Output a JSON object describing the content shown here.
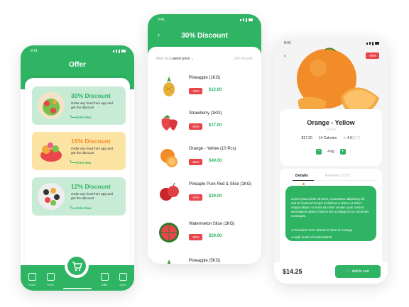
{
  "offer_screen": {
    "time": "9:41",
    "title": "Offer",
    "offers": [
      {
        "title": "30% Discount",
        "desc": "Order any food from app and get the discount",
        "cta": "Order Now"
      },
      {
        "title": "15% Discount",
        "desc": "Order any food from app and get the discount",
        "cta": "Order Now"
      },
      {
        "title": "12% Discount",
        "desc": "Order any food from app and get the discount",
        "cta": "Order Now"
      }
    ],
    "nav": [
      "Home",
      "Order",
      "Offer",
      "More"
    ]
  },
  "discount_screen": {
    "time": "9:41",
    "back": "‹",
    "title": "30% Discount",
    "filter_label": "Filter by",
    "filter_value": "Lowest price",
    "results": "305 Results",
    "items": [
      {
        "name": "Pineapple (1KG)",
        "badge": "-40%",
        "price": "$12.00"
      },
      {
        "name": "Strawberry (1KG)",
        "badge": "-50%",
        "price": "$17.00"
      },
      {
        "name": "Orange - Yellow (10 Pcs)",
        "badge": "-55%",
        "price": "$49.00"
      },
      {
        "name": "Pineaple Pure Red & Slice (1KG)",
        "badge": "-40%",
        "price": "$29.00"
      },
      {
        "name": "Watermelon Slice (1KG)",
        "badge": "-30%",
        "price": "$20.00"
      },
      {
        "name": "Pineapple (5KG)",
        "badge": "",
        "price": ""
      }
    ]
  },
  "product_screen": {
    "time": "9:41",
    "back": "‹",
    "discount": "-55%",
    "name": "Orange - Yellow",
    "subtitle": "10 Pcs",
    "price_small": "$17.20",
    "calories": "14 Calories",
    "rating": "4.5",
    "rating_count": "(217)",
    "qty": "4 kg",
    "tab_details": "Details",
    "tab_reviews": "Reviews (217)",
    "description": "Lorem ipsum dolor sit amet, consectetur adipiscing elit, sed do eiusmod tempor incididunt ut labore et dolore magna aliqua. Ut enim ad minim veniam, quis nostrud exercitation ullamco laboris nisi ut aliquip ex ea commodo consequat.",
    "bullets": [
      "Provides more vitamin C than an orange",
      "High levels of antioxidants"
    ],
    "total": "$14.25",
    "add_to_cart": "Add to cart"
  },
  "colors": {
    "primary_green": "#2fb464",
    "sale_red": "#e8464b"
  }
}
